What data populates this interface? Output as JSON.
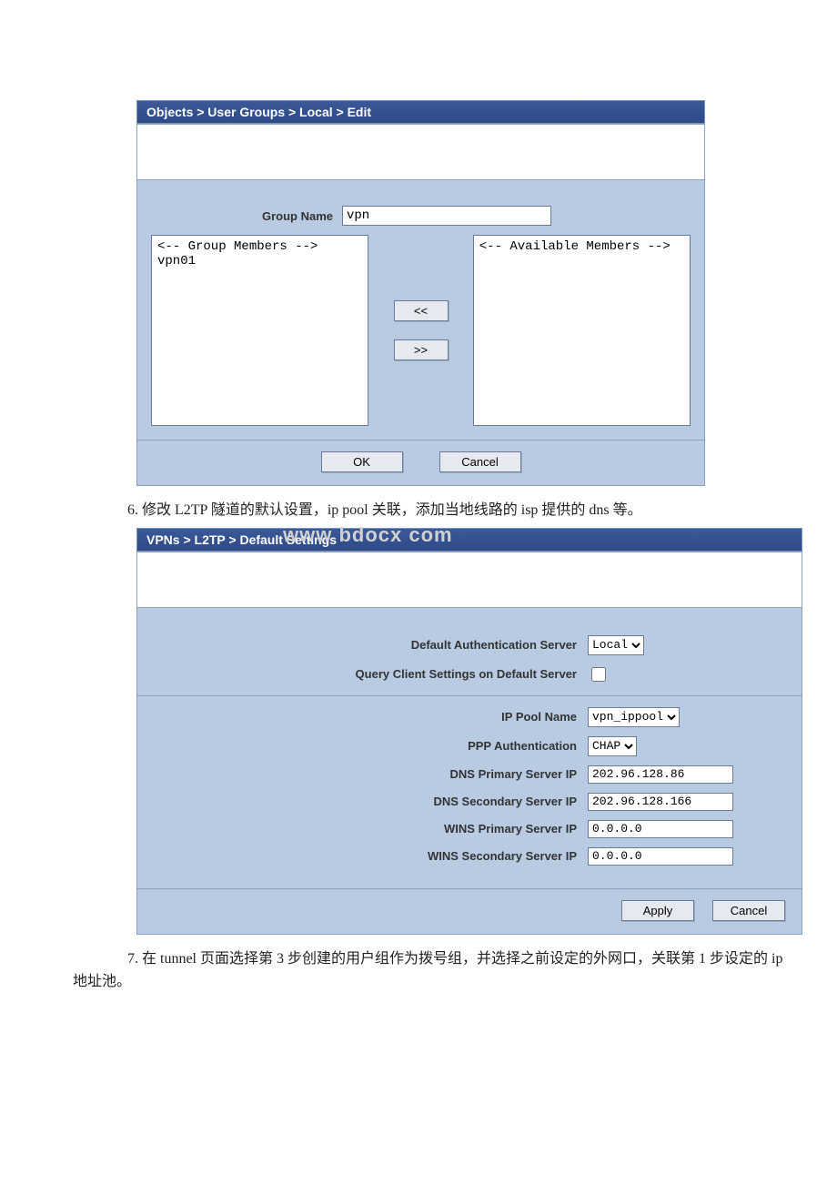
{
  "section1": {
    "breadcrumb": "Objects > User Groups > Local > Edit",
    "group_name": {
      "label": "Group Name",
      "value": "vpn"
    },
    "group_members": {
      "header": "<-- Group Members -->",
      "items": [
        "vpn01"
      ]
    },
    "available_members": {
      "header": "<-- Available Members -->",
      "items": []
    },
    "buttons": {
      "add": "<<",
      "remove": ">>",
      "ok": "OK",
      "cancel": "Cancel"
    }
  },
  "step6_text": "6. 修改 L2TP 隧道的默认设置，ip pool 关联，添加当地线路的 isp 提供的 dns 等。",
  "watermark": "www  bdocx  com",
  "section2": {
    "breadcrumb": "VPNs > L2TP > Default Settings",
    "rows": {
      "auth_server": {
        "label": "Default Authentication Server",
        "value": "Local"
      },
      "query_client": {
        "label": "Query Client Settings on Default Server",
        "checked": false
      },
      "ip_pool": {
        "label": "IP Pool Name",
        "value": "vpn_ippool"
      },
      "ppp_auth": {
        "label": "PPP Authentication",
        "value": "CHAP"
      },
      "dns_primary": {
        "label": "DNS Primary Server IP",
        "value": "202.96.128.86"
      },
      "dns_secondary": {
        "label": "DNS Secondary Server IP",
        "value": "202.96.128.166"
      },
      "wins_primary": {
        "label": "WINS Primary Server IP",
        "value": "0.0.0.0"
      },
      "wins_secondary": {
        "label": "WINS Secondary Server IP",
        "value": "0.0.0.0"
      }
    },
    "buttons": {
      "apply": "Apply",
      "cancel": "Cancel"
    }
  },
  "step7_text": "7. 在 tunnel 页面选择第 3 步创建的用户组作为拨号组，并选择之前设定的外网口，关联第 1 步设定的 ip 地址池。"
}
